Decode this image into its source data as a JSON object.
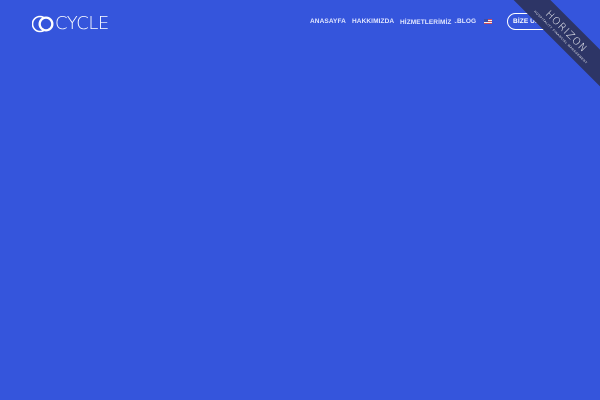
{
  "brand": {
    "logo_text": "CYCLE",
    "logo_icon": "cycle-logo-icon"
  },
  "nav": {
    "items": [
      {
        "label": "ANASAYFA"
      },
      {
        "label": "HAKKIMIZDA"
      },
      {
        "label": "HİZMETLERİMİZ",
        "has_dropdown": true,
        "icon": "chevron-down-icon"
      },
      {
        "label": "BLOG"
      }
    ],
    "language_icon": "us-flag-icon"
  },
  "cta": {
    "label": "BİZE ULAŞIN"
  },
  "ribbon": {
    "title": "HORIZON",
    "subtitle": "HOSPITALITY FINANCIAL MANAGEMENT"
  },
  "colors": {
    "background": "#3555DC",
    "ribbon": "#2D3566",
    "text": "#FFFFFF"
  }
}
